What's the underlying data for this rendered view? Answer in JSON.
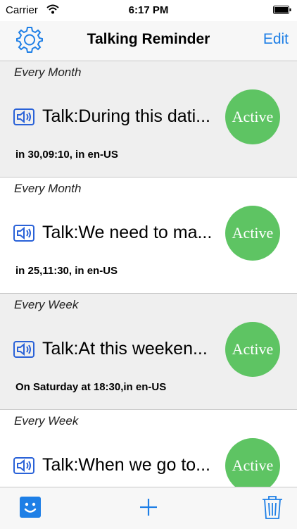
{
  "status_bar": {
    "carrier": "Carrier",
    "time": "6:17 PM"
  },
  "nav": {
    "title": "Talking Reminder",
    "edit_label": "Edit",
    "left_icon": "gear-icon"
  },
  "reminders": [
    {
      "frequency": "Every Month",
      "talk": "Talk:During this dati...",
      "detail": "in 30,09:10, in en-US",
      "status": "Active"
    },
    {
      "frequency": "Every Month",
      "talk": "Talk:We need to ma...",
      "detail": "in 25,11:30, in en-US",
      "status": "Active"
    },
    {
      "frequency": "Every Week",
      "talk": "Talk:At this weeken...",
      "detail": "On Saturday at 18:30,in en-US",
      "status": "Active"
    },
    {
      "frequency": "Every Week",
      "talk": "Talk:When we go to...",
      "detail": "",
      "status": "Active"
    }
  ],
  "toolbar": {
    "left_icon": "smiley-icon",
    "center_icon": "plus-icon",
    "right_icon": "trash-icon"
  },
  "colors": {
    "accent": "#1e7fe6",
    "active_badge": "#5ec463",
    "row_shaded": "#efefef"
  }
}
